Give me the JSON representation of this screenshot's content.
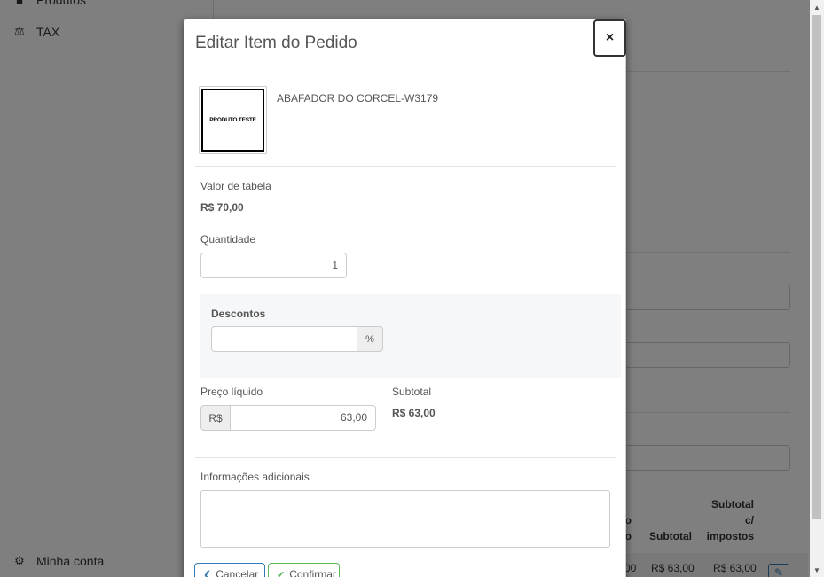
{
  "sidebar": {
    "items": [
      {
        "label": "Produtos",
        "icon": "box-icon"
      },
      {
        "label": "TAX",
        "icon": "scale-icon"
      },
      {
        "label": "Minha conta",
        "icon": "gear-icon"
      }
    ]
  },
  "background_table": {
    "headers": [
      "o\no",
      "Subtotal",
      "Subtotal\nc/\nimpostos"
    ],
    "row": {
      "c1": "00",
      "subtotal": "R$ 63,00",
      "subtotal_tax": "R$ 63,00"
    }
  },
  "modal": {
    "title": "Editar Item do Pedido",
    "close_label": "×",
    "product": {
      "image_text": "PRODUTO TESTE",
      "name": "ABAFADOR DO CORCEL-W3179"
    },
    "list_price_label": "Valor de tabela",
    "list_price_value": "R$ 70,00",
    "quantity_label": "Quantidade",
    "quantity_value": "1",
    "discounts_label": "Descontos",
    "discount_value": "",
    "discount_addon": "%",
    "net_price_label": "Preço líquido",
    "net_price_addon": "R$",
    "net_price_value": "63,00",
    "subtotal_label": "Subtotal",
    "subtotal_value": "R$ 63,00",
    "notes_label": "Informações adicionais",
    "notes_value": "",
    "cancel_label": "Cancelar",
    "confirm_label": "Confirmar"
  }
}
